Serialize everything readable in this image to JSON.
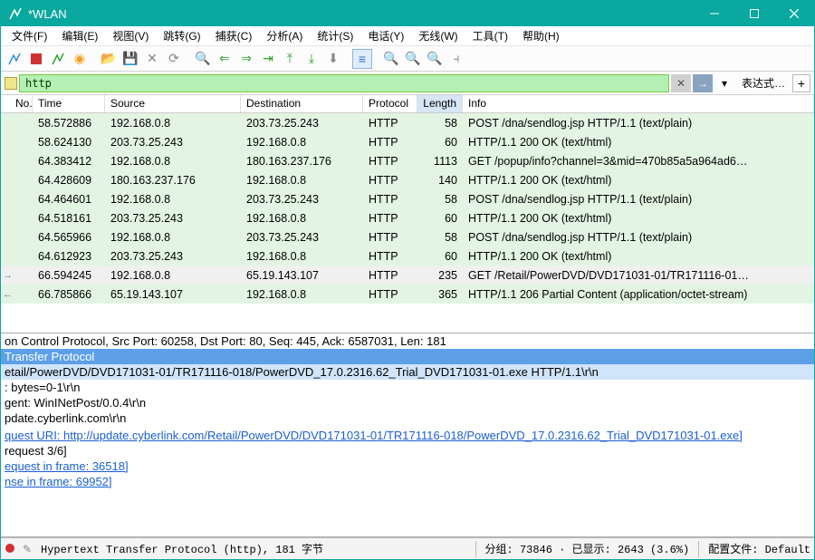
{
  "title": "*WLAN",
  "menus": [
    "文件(F)",
    "编辑(E)",
    "视图(V)",
    "跳转(G)",
    "捕获(C)",
    "分析(A)",
    "统计(S)",
    "电话(Y)",
    "无线(W)",
    "工具(T)",
    "帮助(H)"
  ],
  "filter_value": "http",
  "filter_expr_label": "表达式…",
  "columns": [
    "No.",
    "Time",
    "Source",
    "Destination",
    "Protocol",
    "Length",
    "Info"
  ],
  "rows": [
    {
      "time": "58.572886",
      "src": "192.168.0.8",
      "dst": "203.73.25.243",
      "proto": "HTTP",
      "len": "58",
      "info": "POST /dna/sendlog.jsp HTTP/1.1  (text/plain)"
    },
    {
      "time": "58.624130",
      "src": "203.73.25.243",
      "dst": "192.168.0.8",
      "proto": "HTTP",
      "len": "60",
      "info": "HTTP/1.1 200 OK  (text/html)"
    },
    {
      "time": "64.383412",
      "src": "192.168.0.8",
      "dst": "180.163.237.176",
      "proto": "HTTP",
      "len": "1113",
      "info": "GET /popup/info?channel=3&mid=470b85a5a964ad6…"
    },
    {
      "time": "64.428609",
      "src": "180.163.237.176",
      "dst": "192.168.0.8",
      "proto": "HTTP",
      "len": "140",
      "info": "HTTP/1.1 200 OK  (text/html)"
    },
    {
      "time": "64.464601",
      "src": "192.168.0.8",
      "dst": "203.73.25.243",
      "proto": "HTTP",
      "len": "58",
      "info": "POST /dna/sendlog.jsp HTTP/1.1  (text/plain)"
    },
    {
      "time": "64.518161",
      "src": "203.73.25.243",
      "dst": "192.168.0.8",
      "proto": "HTTP",
      "len": "60",
      "info": "HTTP/1.1 200 OK  (text/html)"
    },
    {
      "time": "64.565966",
      "src": "192.168.0.8",
      "dst": "203.73.25.243",
      "proto": "HTTP",
      "len": "58",
      "info": "POST /dna/sendlog.jsp HTTP/1.1  (text/plain)"
    },
    {
      "time": "64.612923",
      "src": "203.73.25.243",
      "dst": "192.168.0.8",
      "proto": "HTTP",
      "len": "60",
      "info": "HTTP/1.1 200 OK  (text/html)"
    },
    {
      "time": "66.594245",
      "src": "192.168.0.8",
      "dst": "65.19.143.107",
      "proto": "HTTP",
      "len": "235",
      "info": "GET /Retail/PowerDVD/DVD171031-01/TR171116-01…",
      "sel": true,
      "arrow": "→"
    },
    {
      "time": "66.785866",
      "src": "65.19.143.107",
      "dst": "192.168.0.8",
      "proto": "HTTP",
      "len": "365",
      "info": "HTTP/1.1 206 Partial Content  (application/octet-stream)",
      "arrow": "←"
    }
  ],
  "details": [
    {
      "txt": "on Control Protocol, Src Port: 60258, Dst Port: 80, Seq: 445, Ack: 6587031, Len: 181"
    },
    {
      "txt": "Transfer Protocol",
      "cls": "hl"
    },
    {
      "txt": "etail/PowerDVD/DVD171031-01/TR171116-018/PowerDVD_17.0.2316.62_Trial_DVD171031-01.exe HTTP/1.1\\r\\n",
      "cls": "hl2"
    },
    {
      "txt": ": bytes=0-1\\r\\n"
    },
    {
      "txt": "gent: WinINetPost/0.0.4\\r\\n"
    },
    {
      "txt": "pdate.cyberlink.com\\r\\n"
    },
    {
      "txt": ""
    },
    {
      "txt": "quest URI: http://update.cyberlink.com/Retail/PowerDVD/DVD171031-01/TR171116-018/PowerDVD_17.0.2316.62_Trial_DVD171031-01.exe]",
      "cls": "link"
    },
    {
      "txt": "request 3/6]"
    },
    {
      "txt": "equest in frame: 36518]",
      "cls": "link"
    },
    {
      "txt": "nse in frame: 69952]",
      "cls": "link"
    }
  ],
  "status": {
    "main": "Hypertext Transfer Protocol (http), 181 字节",
    "pkts": "分组: 73846  ·  已显示: 2643 (3.6%)",
    "profile": "配置文件: Default"
  }
}
